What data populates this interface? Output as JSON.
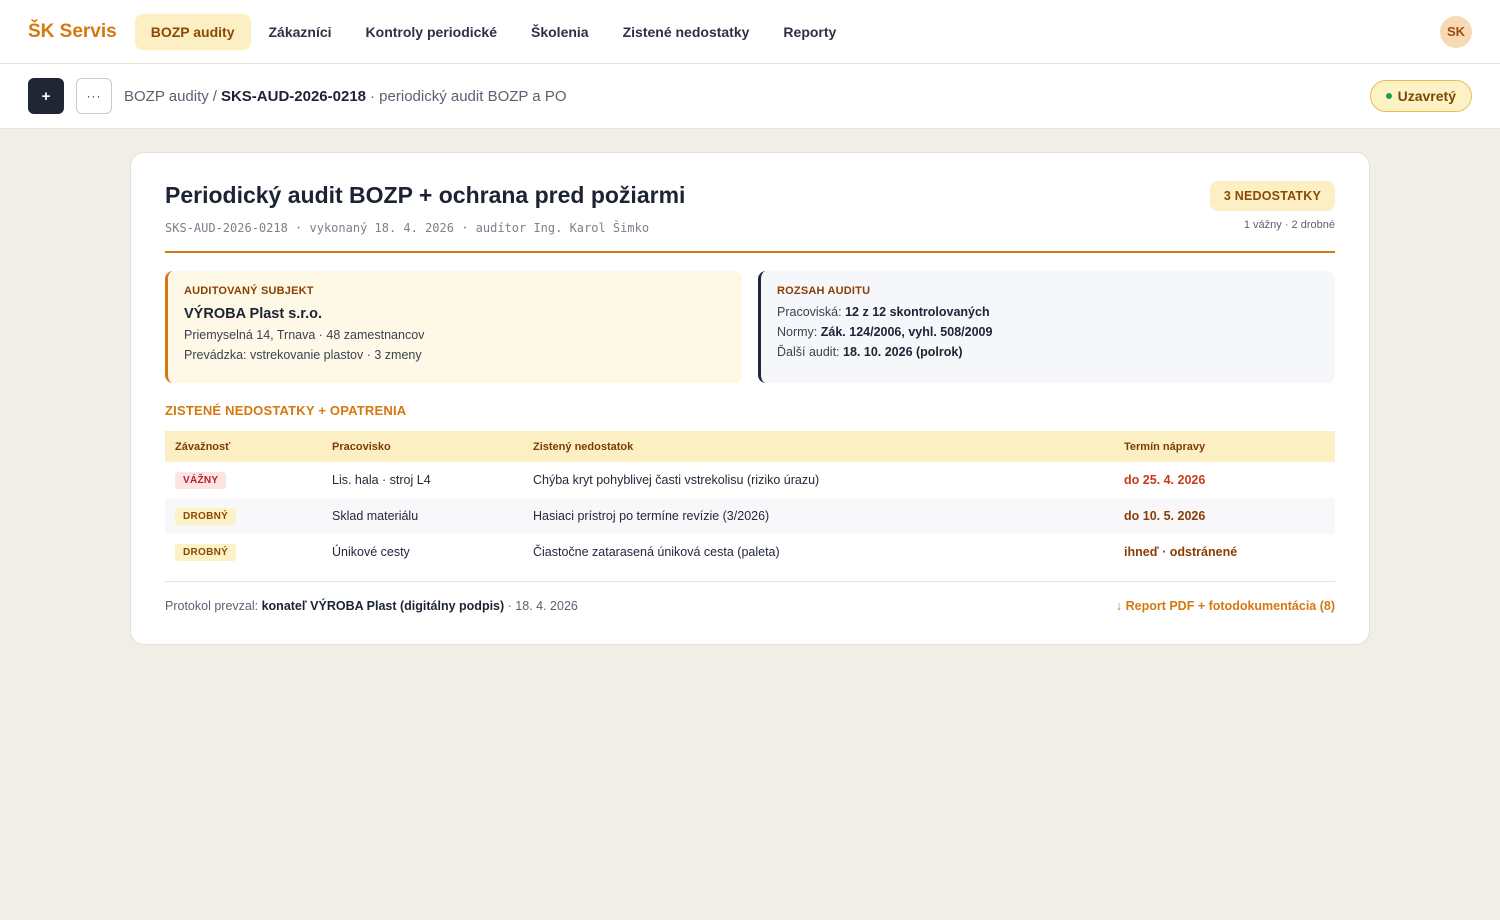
{
  "brand": "ŠK Servis",
  "nav": [
    "BOZP audity",
    "Zákazníci",
    "Kontroly periodické",
    "Školenia",
    "Zistené nedostatky",
    "Reporty"
  ],
  "user_initials": "SK",
  "toolbar": {
    "add_label": "+",
    "more_label": "···",
    "crumb_root": "BOZP audity",
    "crumb_sep": "/",
    "crumb_id": "SKS-AUD-2026-0218",
    "crumb_desc": "· periodický audit BOZP a PO",
    "status": "Uzavretý",
    "status_color": "#1f9d4a"
  },
  "audit": {
    "title": "Periodický audit BOZP + ochrana pred požiarmi",
    "meta": "SKS-AUD-2026-0218 · vykonaný 18. 4. 2026 · audítor Ing. Karol Šimko",
    "count_badge": "3 NEDOSTATKY",
    "count_sub": "1 vážny · 2 drobné",
    "subject": {
      "label": "AUDITOVANÝ SUBJEKT",
      "name": "VÝROBA Plast s.r.o.",
      "line1": "Priemyselná 14, Trnava · 48 zamestnancov",
      "line2": "Prevádzka: vstrekovanie plastov · 3 zmeny"
    },
    "scope": {
      "label": "ROZSAH AUDITU",
      "items": [
        {
          "k": "Pracoviská:",
          "v": "12 z 12 skontrolovaných"
        },
        {
          "k": "Normy:",
          "v": "Zák. 124/2006, vyhl. 508/2009"
        },
        {
          "k": "Ďalší audit:",
          "v": "18. 10. 2026 (polrok)"
        }
      ]
    },
    "section_title": "ZISTENÉ NEDOSTATKY + OPATRENIA",
    "columns": [
      "Závažnosť",
      "Pracovisko",
      "Zistený nedostatok",
      "Termín nápravy"
    ],
    "rows": [
      {
        "severity": "VÁŽNY",
        "place": "Lis. hala · stroj L4",
        "finding": "Chýba kryt pohyblivej časti vstrekolisu (riziko úrazu)",
        "due": "do 25. 4. 2026"
      },
      {
        "severity": "DROBNÝ",
        "place": "Sklad materiálu",
        "finding": "Hasiaci prístroj po termíne revízie (3/2026)",
        "due": "do 10. 5. 2026"
      },
      {
        "severity": "DROBNÝ",
        "place": "Únikové cesty",
        "finding": "Čiastočne zatarasená úniková cesta (paleta)",
        "due": "ihneď · odstránené"
      }
    ],
    "footer": {
      "received_label": "Protokol prevzal:",
      "received_by": "konateľ VÝROBA Plast (digitálny podpis)",
      "received_date": "· 18. 4. 2026",
      "report_link": "↓ Report PDF + fotodokumentácia (8)"
    }
  }
}
